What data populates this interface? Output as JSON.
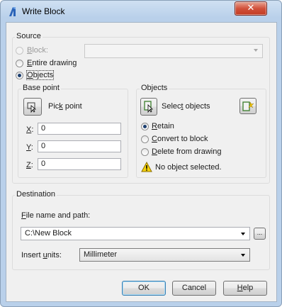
{
  "window": {
    "title": "Write Block",
    "close_glyph": "✕"
  },
  "source": {
    "label": "Source",
    "options": [
      {
        "pre": "",
        "key": "B",
        "post": "lock:",
        "selected": false,
        "enabled": false
      },
      {
        "pre": "",
        "key": "E",
        "post": "ntire drawing",
        "selected": false,
        "enabled": true
      },
      {
        "pre": "",
        "key": "O",
        "post": "bjects",
        "selected": true,
        "enabled": true
      }
    ],
    "block_select_value": ""
  },
  "base_point": {
    "label": "Base point",
    "pick": {
      "pre": "Pic",
      "key": "k",
      "post": " point"
    },
    "x": {
      "key": "X",
      "post": ":",
      "value": "0"
    },
    "y": {
      "key": "Y",
      "post": ":",
      "value": "0"
    },
    "z": {
      "key": "Z",
      "post": ":",
      "value": "0"
    }
  },
  "objects": {
    "label": "Objects",
    "select": {
      "pre": "Selec",
      "key": "t",
      "post": " objects"
    },
    "options": [
      {
        "pre": "",
        "key": "R",
        "post": "etain",
        "selected": true
      },
      {
        "pre": "",
        "key": "C",
        "post": "onvert to block",
        "selected": false
      },
      {
        "pre": "",
        "key": "D",
        "post": "elete from drawing",
        "selected": false
      }
    ],
    "status": "No object selected."
  },
  "destination": {
    "label": "Destination",
    "file_label": {
      "key": "F",
      "post": "ile name and path:"
    },
    "file_value": "C:\\New Block",
    "browse_label": "...",
    "units_label": {
      "pre": "Insert ",
      "key": "u",
      "post": "nits:"
    },
    "units_value": "Millimeter"
  },
  "buttons": {
    "ok": "OK",
    "cancel": "Cancel",
    "help": {
      "key": "H",
      "post": "elp"
    }
  },
  "colors": {
    "title_bar": "#b9d0ea",
    "close_button": "#c9452e",
    "warning": "#f5d20a"
  }
}
